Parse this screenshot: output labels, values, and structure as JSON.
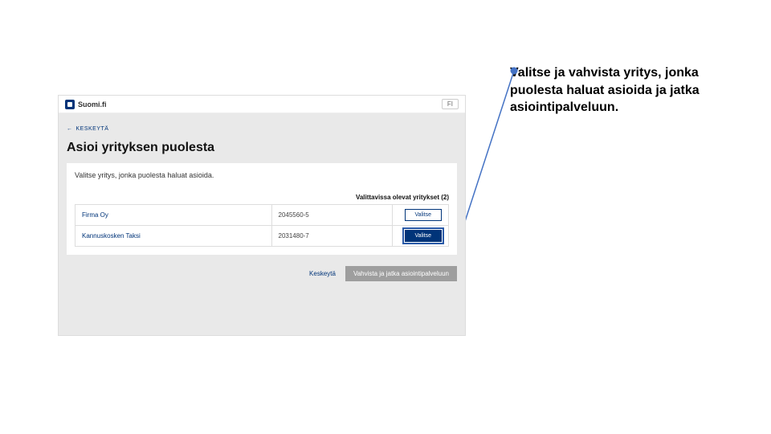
{
  "annotation": "Valitse ja vahvista yritys, jonka puolesta haluat asioida ja jatka asiointipalveluun.",
  "header": {
    "brand": "Suomi.fi",
    "lang": "FI"
  },
  "back": {
    "arrow": "←",
    "label": "KESKEYTÄ"
  },
  "page_title": "Asioi yrityksen puolesta",
  "subtitle": "Valitse yritys, jonka puolesta haluat asioida.",
  "table": {
    "count_label": "Valittavissa olevat yritykset (2)",
    "rows": [
      {
        "name": "Firma Oy",
        "id": "2045560-5",
        "select": "Valitse"
      },
      {
        "name": "Kannuskosken Taksi",
        "id": "2031480-7",
        "select": "Valitse"
      }
    ]
  },
  "footer": {
    "cancel": "Keskeytä",
    "continue": "Vahvista ja jatka asiointipalveluun"
  }
}
